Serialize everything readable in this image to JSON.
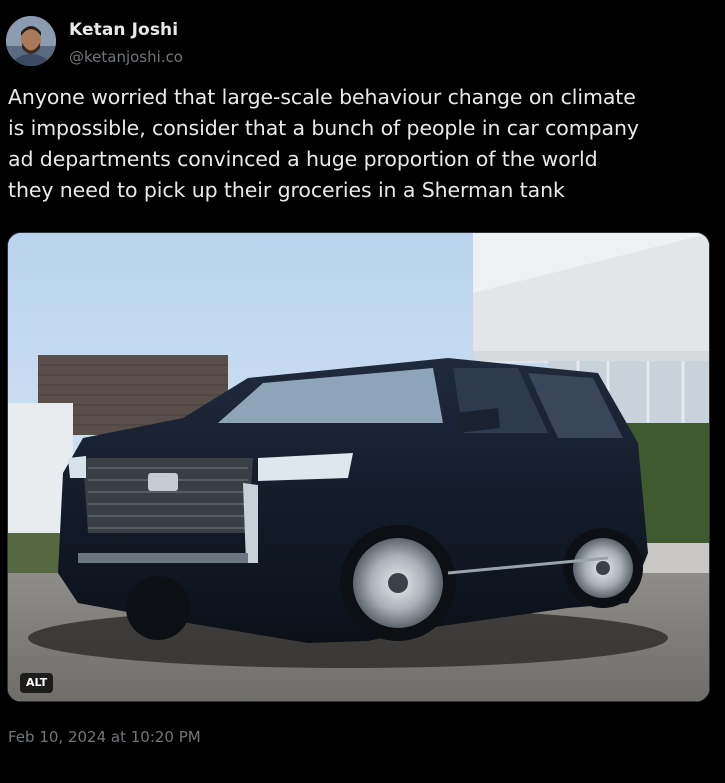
{
  "author": {
    "name": "Ketan Joshi",
    "handle": "@ketanjoshi.co"
  },
  "post": {
    "text_lines": [
      "Anyone worried that large-scale behaviour change on climate",
      "is impossible, consider that a bunch of people in car company",
      "ad departments convinced a huge proportion of the world",
      "they need to pick up their groceries in a Sherman tank"
    ],
    "timestamp": "Feb 10, 2024 at 10:20 PM"
  },
  "media": {
    "alt_label": "ALT"
  },
  "colors": {
    "background": "#000000",
    "primary_text": "#e7e9ea",
    "secondary_text": "#71767b"
  }
}
